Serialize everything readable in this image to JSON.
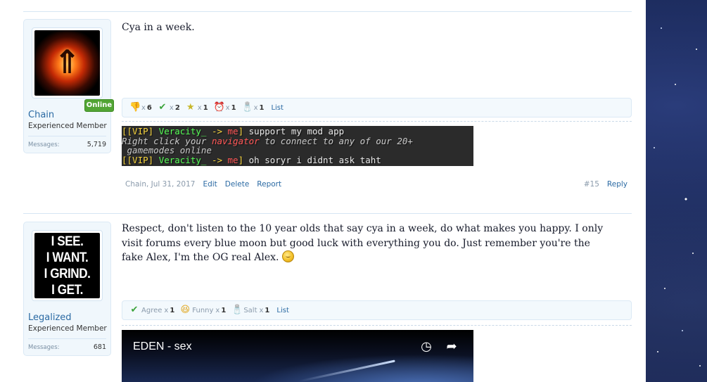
{
  "posts": [
    {
      "user": {
        "name": "Chain",
        "title": "Experienced Member",
        "online_label": "Online",
        "stat_label": "Messages:",
        "stat_value": "5,719"
      },
      "message": "Cya in a week.",
      "ratings": [
        {
          "icon": "thumbs-down-icon",
          "glyph": "👎",
          "name": "",
          "count": "6"
        },
        {
          "icon": "checkmark-icon",
          "glyph": "✔",
          "name": "",
          "count": "2"
        },
        {
          "icon": "star-icon",
          "glyph": "★",
          "name": "",
          "count": "1"
        },
        {
          "icon": "alarm-clock-icon",
          "glyph": "⏰",
          "name": "",
          "count": "1"
        },
        {
          "icon": "salt-shaker-icon",
          "glyph": "🧂",
          "name": "",
          "count": "1"
        }
      ],
      "ratings_x": "x",
      "list_label": "List",
      "signature_lines": [
        [
          {
            "t": "[[VIP] ",
            "c": "yellow"
          },
          {
            "t": "Veracity_ ",
            "c": "green"
          },
          {
            "t": "-> ",
            "c": "yellow"
          },
          {
            "t": "me",
            "c": "red"
          },
          {
            "t": "] ",
            "c": "yellow"
          },
          {
            "t": "support my mod app",
            "c": "white"
          }
        ],
        [
          {
            "t": "Right click your ",
            "c": "gray"
          },
          {
            "t": "navigator",
            "c": "red-it"
          },
          {
            "t": " to connect to any of our 20+",
            "c": "gray"
          }
        ],
        [
          {
            "t": " gamemodes online",
            "c": "gray"
          }
        ],
        [
          {
            "t": "[[VIP] ",
            "c": "yellow"
          },
          {
            "t": "Veracity_ ",
            "c": "green"
          },
          {
            "t": "-> ",
            "c": "yellow"
          },
          {
            "t": "me",
            "c": "red"
          },
          {
            "t": "] ",
            "c": "yellow"
          },
          {
            "t": "oh soryr i didnt ask taht",
            "c": "white"
          }
        ]
      ],
      "meta": {
        "author_date": "Chain, Jul 31, 2017",
        "edit": "Edit",
        "delete": "Delete",
        "report": "Report",
        "post_number": "#15",
        "reply": "Reply"
      }
    },
    {
      "user": {
        "name": "Legalized",
        "title": "Experienced Member",
        "avatar_text": [
          "I SEE.",
          "I WANT.",
          "I GRIND.",
          "I GET."
        ],
        "stat_label": "Messages:",
        "stat_value": "681"
      },
      "message": "Respect, don't listen to the 10 year olds that say cya in a week, do what makes you happy. I only visit forums every blue moon but good luck with everything you do. Just remember you're the fake Alex, I'm the OG real Alex.",
      "ratings": [
        {
          "icon": "checkmark-icon",
          "glyph": "✔",
          "name": "Agree",
          "count": "1"
        },
        {
          "icon": "funny-face-icon",
          "glyph": "😆",
          "name": "Funny",
          "count": "1"
        },
        {
          "icon": "salt-shaker-icon",
          "glyph": "🧂",
          "name": "Salt",
          "count": "1"
        }
      ],
      "ratings_x": "x",
      "list_label": "List",
      "video": {
        "title": "EDEN - sex",
        "watch_later_icon": "clock-icon",
        "share_icon": "share-icon"
      }
    }
  ],
  "colors": {
    "link": "#2b6aa3",
    "online": "#52a534",
    "accent_bg": "#f0f7fc"
  }
}
